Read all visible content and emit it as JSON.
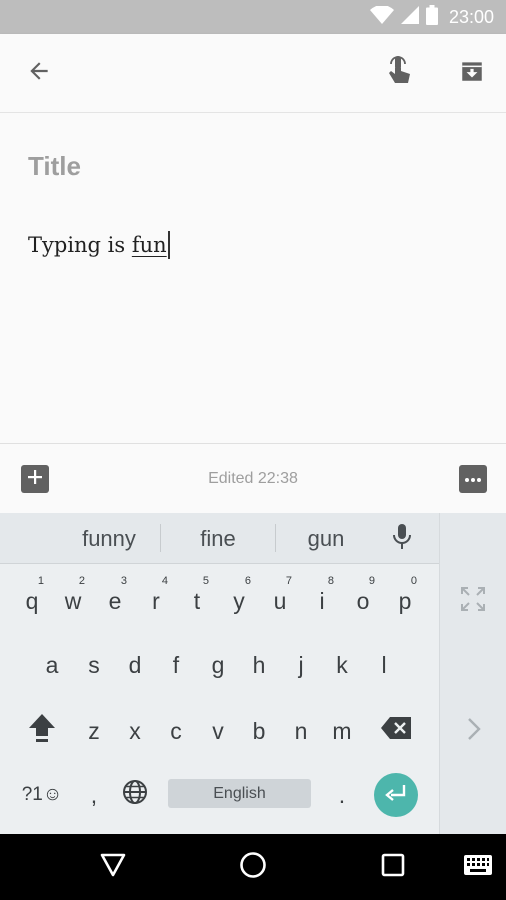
{
  "status_bar": {
    "time": "23:00",
    "icons": [
      "wifi-icon",
      "signal-icon",
      "battery-icon"
    ]
  },
  "toolbar": {
    "back_icon": "arrow-back-icon",
    "actions": [
      "touch-gesture-icon",
      "archive-icon"
    ]
  },
  "note": {
    "title_placeholder": "Title",
    "body_prefix": "Typing is ",
    "body_composing": "fun"
  },
  "bottom_bar": {
    "edited": "Edited 22:38",
    "left_icon": "add-box-icon",
    "right_icon": "more-icon"
  },
  "keyboard": {
    "suggestions": [
      "funny",
      "fine",
      "gun"
    ],
    "row1": [
      {
        "key": "q",
        "hint": "1"
      },
      {
        "key": "w",
        "hint": "2"
      },
      {
        "key": "e",
        "hint": "3"
      },
      {
        "key": "r",
        "hint": "4"
      },
      {
        "key": "t",
        "hint": "5"
      },
      {
        "key": "y",
        "hint": "6"
      },
      {
        "key": "u",
        "hint": "7"
      },
      {
        "key": "i",
        "hint": "8"
      },
      {
        "key": "o",
        "hint": "9"
      },
      {
        "key": "p",
        "hint": "0"
      }
    ],
    "row2": [
      "a",
      "s",
      "d",
      "f",
      "g",
      "h",
      "j",
      "k",
      "l"
    ],
    "row3": [
      "z",
      "x",
      "c",
      "v",
      "b",
      "n",
      "m"
    ],
    "symbols_label": "?1☺",
    "comma": ",",
    "period": ".",
    "space_label": "English",
    "accent_color": "#4db6ac"
  },
  "nav_bar": {
    "icons": [
      "back-triangle-icon",
      "home-circle-icon",
      "recents-square-icon",
      "keyboard-switch-icon"
    ]
  }
}
